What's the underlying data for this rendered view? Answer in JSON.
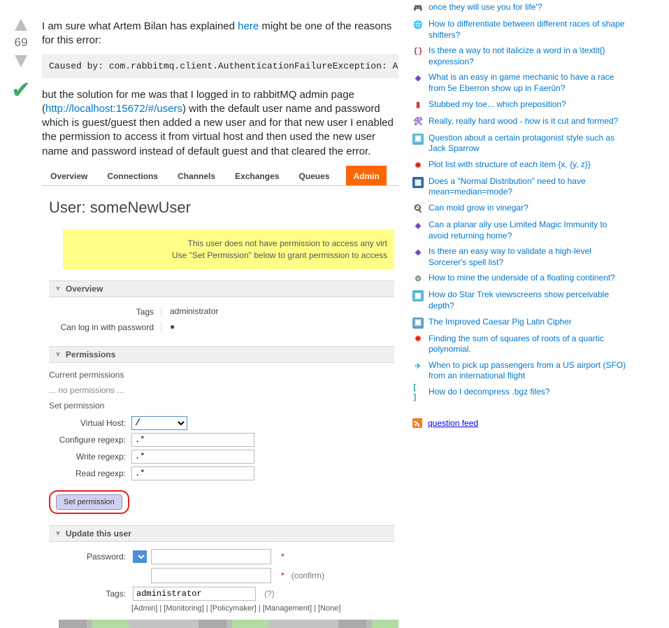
{
  "vote": {
    "count": "69"
  },
  "answer": {
    "intro_pre": "I am sure what Artem Bilan has explained ",
    "here_link": "here",
    "intro_post": " might be one of the reasons for this error:",
    "code": "Caused by: com.rabbitmq.client.AuthenticationFailureException: ACCESS_REFUSED - Login was refused using authentication mechanism PLAIN.",
    "sol_pre": "but the solution for me was that I logged in to rabbitMQ admin page (",
    "sol_link": "http://localhost:15672/#/users",
    "sol_post": ") with the default user name and password which is guest/guest then added a new user and for that new user I enabled the permission to access it from virtual host and then used the new user name and password instead of default guest and that cleared the error."
  },
  "rabbit": {
    "tabs": [
      "Overview",
      "Connections",
      "Channels",
      "Exchanges",
      "Queues",
      "Admin"
    ],
    "user_label": "User:",
    "username": "someNewUser",
    "warn_line1": "This user does not have permission to access any virt",
    "warn_line2": "Use \"Set Permission\" below to grant permission to access",
    "overview_header": "Overview",
    "tags_label": "Tags",
    "tags_value": "administrator",
    "login_label": "Can log in with password",
    "login_value": "●",
    "permissions_header": "Permissions",
    "current_perm": "Current permissions",
    "no_perm": "... no permissions ...",
    "set_perm_heading": "Set permission",
    "vhost_label": "Virtual Host:",
    "vhost_value": "/",
    "conf_label": "Configure regexp:",
    "conf_value": ".*",
    "write_label": "Write regexp:",
    "write_value": ".*",
    "read_label": "Read regexp:",
    "read_value": ".*",
    "set_btn": "Set permission",
    "update_header": "Update this user",
    "pw_label": "Password:",
    "confirm_text": "(confirm)",
    "tags_input_label": "Tags:",
    "tags_input_value": "administrator",
    "tags_help": "(?)",
    "tag_roles": "[Admin] | [Monitoring] | [Policymaker] | [Management] | [None]"
  },
  "sidebar": {
    "items": [
      {
        "icon": "🎮",
        "bg": "",
        "text": "once they will use you for life'?",
        "cls": ""
      },
      {
        "icon": "🌐",
        "bg": "",
        "text": "How to differentiate between different races of shape shifters?"
      },
      {
        "icon": "{}",
        "bg": "",
        "text": "Is there a way to not italicize a word in a \\textit{} expression?",
        "cls": "code"
      },
      {
        "icon": "◆",
        "bg": "",
        "text": "What is an easy in game mechanic to have a race from 5e Eberron show up in Faerûn?"
      },
      {
        "icon": "▮",
        "bg": "",
        "text": "Stubbed my toe... which preposition?",
        "cls": "bm"
      },
      {
        "icon": "🛠",
        "bg": "",
        "text": "Really, really hard wood - how is it cut and formed?"
      },
      {
        "icon": "▣",
        "bg": "",
        "text": "Question about a certain protagonist style such as Jack Sparrow",
        "cls": "sf"
      },
      {
        "icon": "❋",
        "bg": "",
        "text": "Plot list with structure of each item {x, {y, z}}",
        "cls": "mm"
      },
      {
        "icon": "▦",
        "bg": "",
        "text": "Does a \"Normal Distribution\" need to have mean=median=mode?",
        "cls": "cv"
      },
      {
        "icon": "🍳",
        "bg": "",
        "text": "Can mold grow in vinegar?"
      },
      {
        "icon": "◆",
        "bg": "",
        "text": "Can a planar ally use Limited Magic Immunity to avoid returning home?"
      },
      {
        "icon": "◆",
        "bg": "",
        "text": "Is there an easy way to validate a high-level Sorcerer's spell list?"
      },
      {
        "icon": "⚙",
        "bg": "",
        "text": "How to mine the underside of a floating continent?",
        "cls": "wb"
      },
      {
        "icon": "▣",
        "bg": "",
        "text": "How do Star Trek viewscreens show perceivable depth?",
        "cls": "sf"
      },
      {
        "icon": "▣",
        "bg": "",
        "text": "The Improved Caesar Pig Latin Cipher",
        "cls": "pz"
      },
      {
        "icon": "❋",
        "bg": "",
        "text": "Finding the sum of squares of roots of a quartic polynomial.",
        "cls": "mm"
      },
      {
        "icon": "✈",
        "bg": "",
        "text": "When to pick up passengers from a US airport (SFO) from an international flight",
        "cls": "tr"
      },
      {
        "icon": "[ ]",
        "bg": "",
        "text": "How do I decompress .bgz files?",
        "cls": "bio"
      }
    ],
    "feed": "question feed"
  }
}
